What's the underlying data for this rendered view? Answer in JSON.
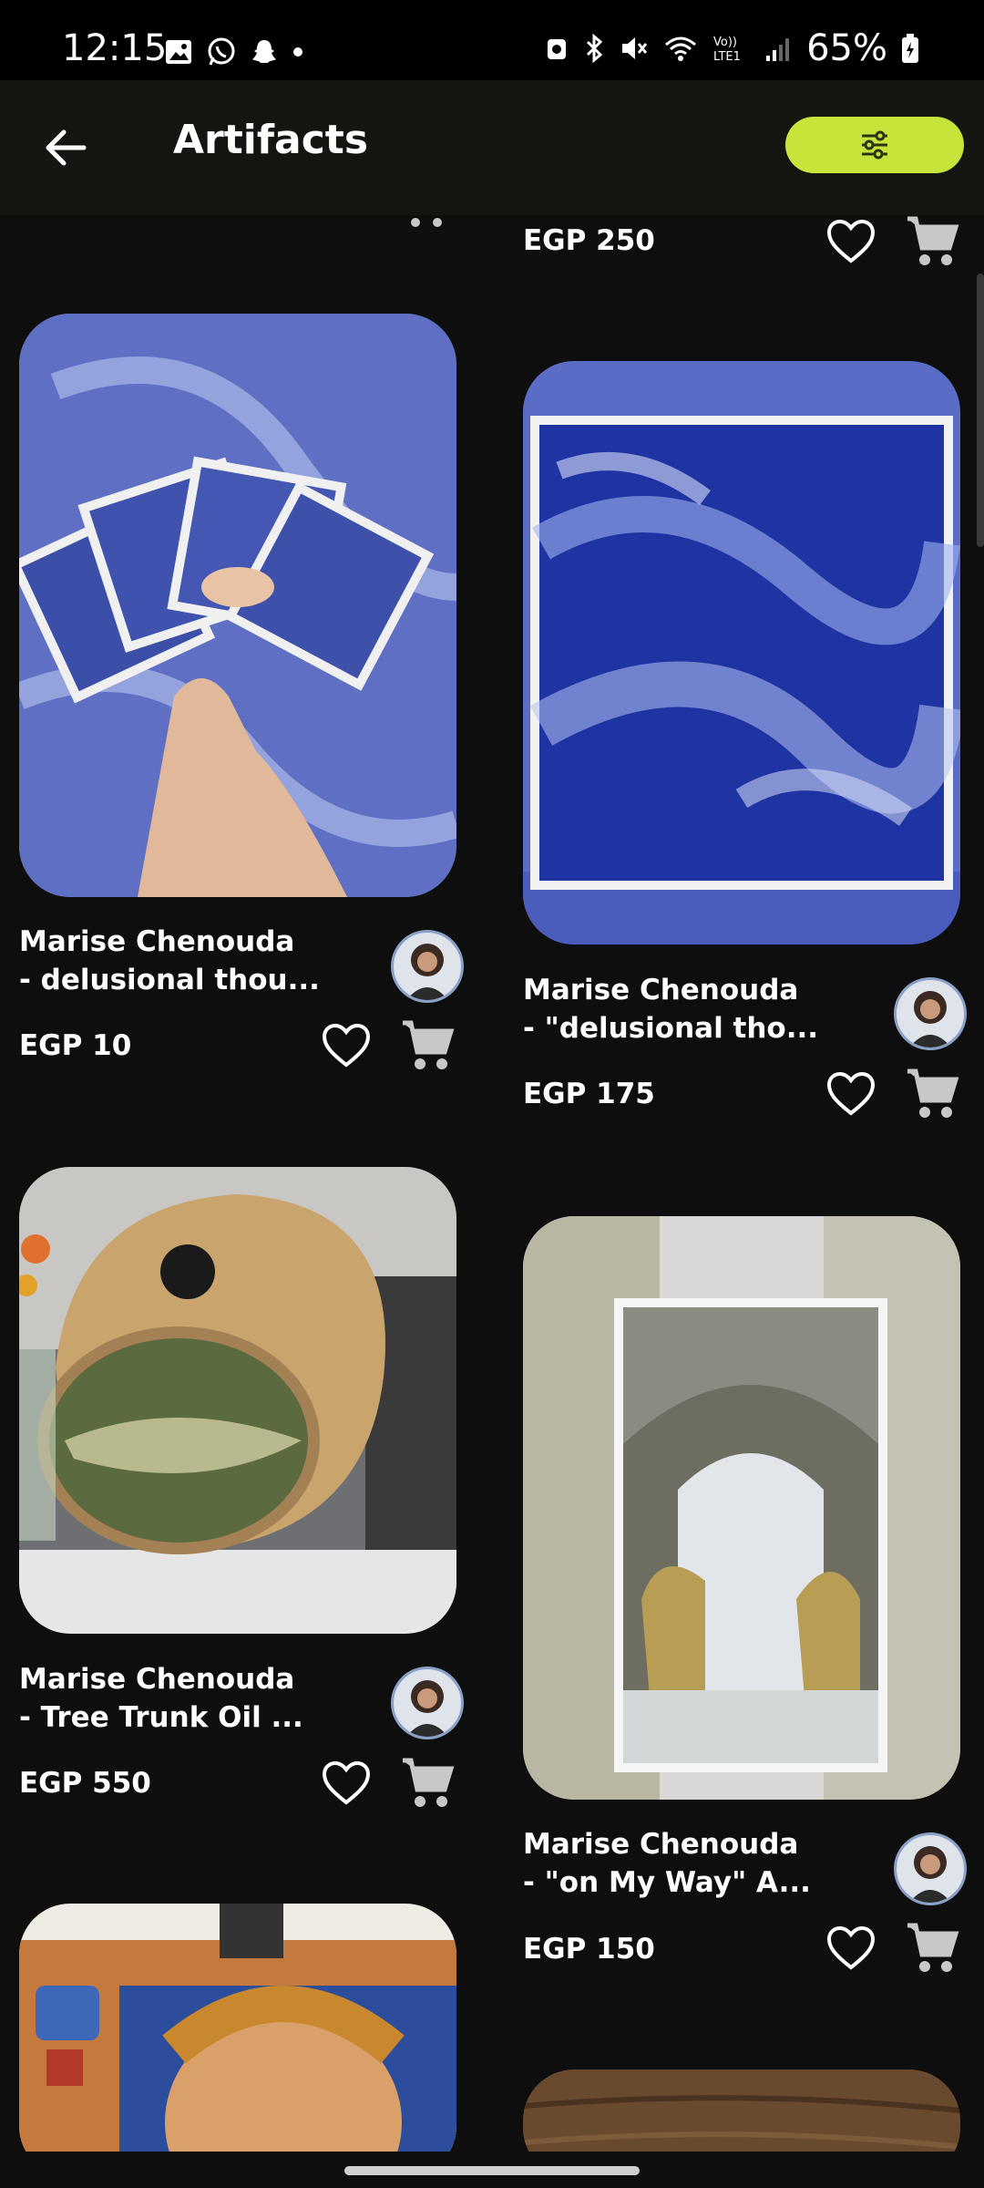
{
  "status_bar": {
    "time": "12:15",
    "battery": "65%",
    "left_icons": [
      "gallery-icon",
      "whatsapp-icon",
      "snapchat-icon",
      "dot-icon"
    ],
    "right_icons": [
      "alarm-icon",
      "bluetooth-icon",
      "mute-icon",
      "wifi-icon",
      "volte-icon",
      "signal-icon",
      "battery-icon"
    ]
  },
  "app_bar": {
    "title": "Artifacts",
    "filter_icon": "sliders-icon",
    "accent": "#c6e43a"
  },
  "items": [
    {
      "name_line1": "",
      "name_line2": "",
      "price": "EGP 250"
    },
    {
      "name_line1": "Marise Chenouda",
      "name_line2": "- delusional thou...",
      "price": "EGP 10"
    },
    {
      "name_line1": "Marise Chenouda",
      "name_line2": "- \"delusional tho...",
      "price": "EGP 175"
    },
    {
      "name_line1": "Marise Chenouda",
      "name_line2": "- Tree Trunk Oil ...",
      "price": "EGP 550"
    },
    {
      "name_line1": "Marise Chenouda",
      "name_line2": "- \"on My Way\" A...",
      "price": "EGP 150"
    }
  ],
  "icons": {
    "favorite": "heart-outline-icon",
    "cart": "shopping-cart-icon"
  }
}
